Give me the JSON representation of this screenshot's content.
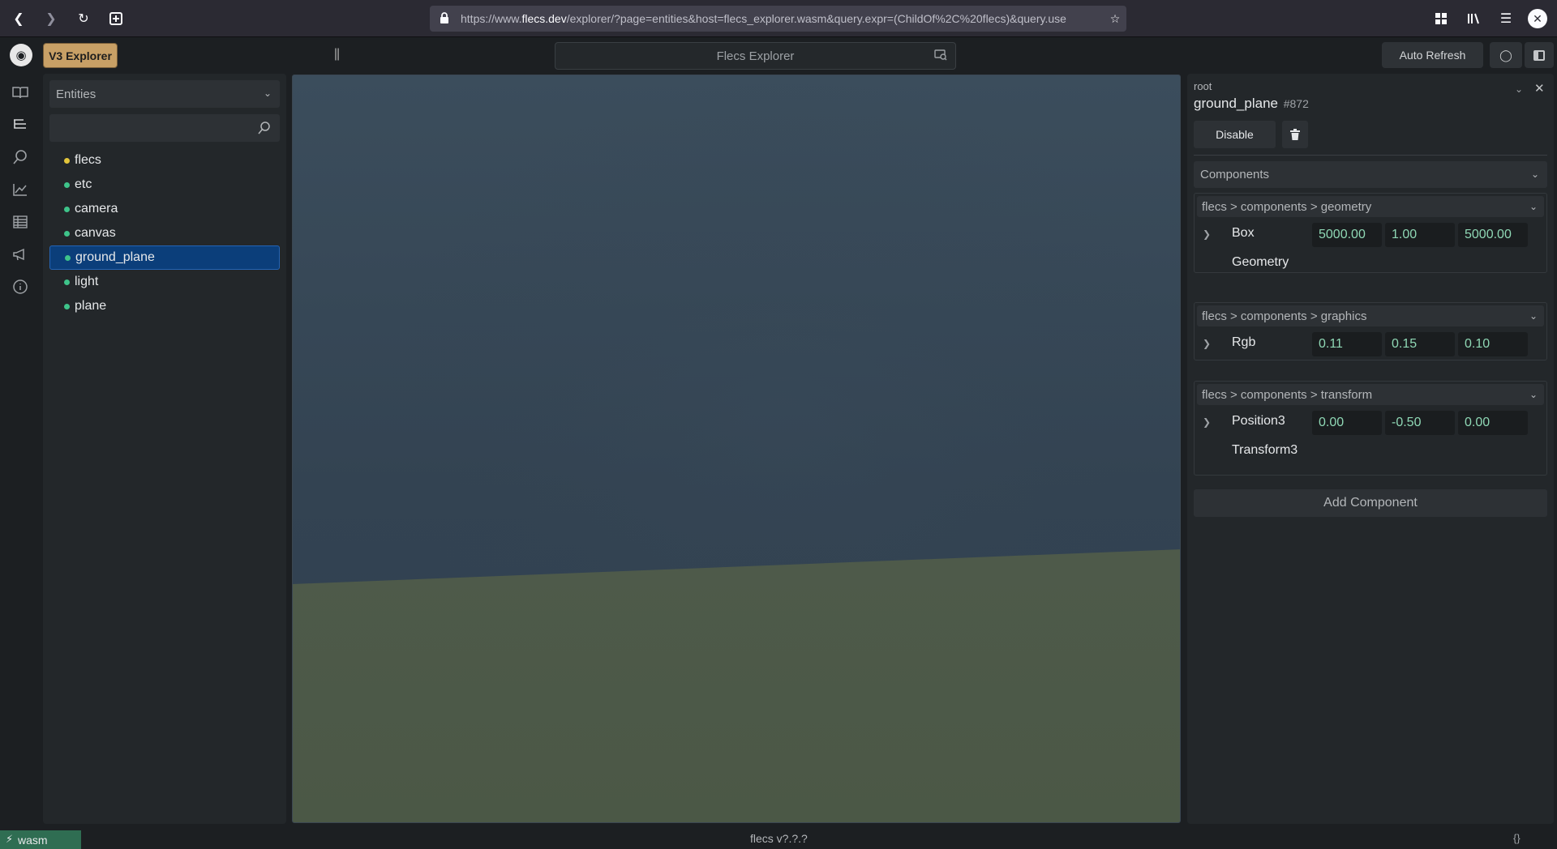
{
  "browser": {
    "url_prefix": "https://www.",
    "url_domain": "flecs.dev",
    "url_rest": "/explorer/?page=entities&host=flecs_explorer.wasm&query.expr=(ChildOf%2C%20flecs)&query.use"
  },
  "header": {
    "v3_label": "V3 Explorer",
    "pause_glyph": "||",
    "search_label": "Flecs Explorer",
    "auto_refresh_label": "Auto Refresh"
  },
  "rail": {
    "icons": [
      "book-icon",
      "tree-icon",
      "search-icon",
      "chart-icon",
      "table-icon",
      "megaphone-icon",
      "info-icon"
    ]
  },
  "entities": {
    "selector_label": "Entities",
    "search_value": "",
    "items": [
      {
        "label": "flecs",
        "dot": "#e2c53b"
      },
      {
        "label": "etc",
        "dot": "#3ec48a"
      },
      {
        "label": "camera",
        "dot": "#3ec48a"
      },
      {
        "label": "canvas",
        "dot": "#3ec48a"
      },
      {
        "label": "ground_plane",
        "dot": "#3ec48a"
      },
      {
        "label": "light",
        "dot": "#3ec48a"
      },
      {
        "label": "plane",
        "dot": "#3ec48a"
      }
    ],
    "selected_index": 4
  },
  "inspector": {
    "path": "root",
    "name": "ground_plane",
    "id": "#872",
    "disable_label": "Disable",
    "components_label": "Components",
    "modules": [
      {
        "title": "flecs > components > geometry",
        "components": [
          {
            "name": "Box",
            "values": [
              "5000.00",
              "1.00",
              "5000.00"
            ]
          }
        ],
        "tags": [
          "Geometry"
        ]
      },
      {
        "title": "flecs > components > graphics",
        "components": [
          {
            "name": "Rgb",
            "values": [
              "0.11",
              "0.15",
              "0.10"
            ]
          }
        ],
        "tags": []
      },
      {
        "title": "flecs > components > transform",
        "components": [
          {
            "name": "Position3",
            "values": [
              "0.00",
              "-0.50",
              "0.00"
            ]
          }
        ],
        "tags": [
          "Transform3"
        ]
      }
    ],
    "add_component_label": "Add Component"
  },
  "status": {
    "wasm_label": "wasm",
    "version": "flecs v?.?.?",
    "braces": "{}"
  },
  "colors": {
    "accent": "#c8a066",
    "selection": "#0b3e7a",
    "value_text": "#8fd8b5",
    "sky": "#344554",
    "ground": "#4d5947"
  }
}
